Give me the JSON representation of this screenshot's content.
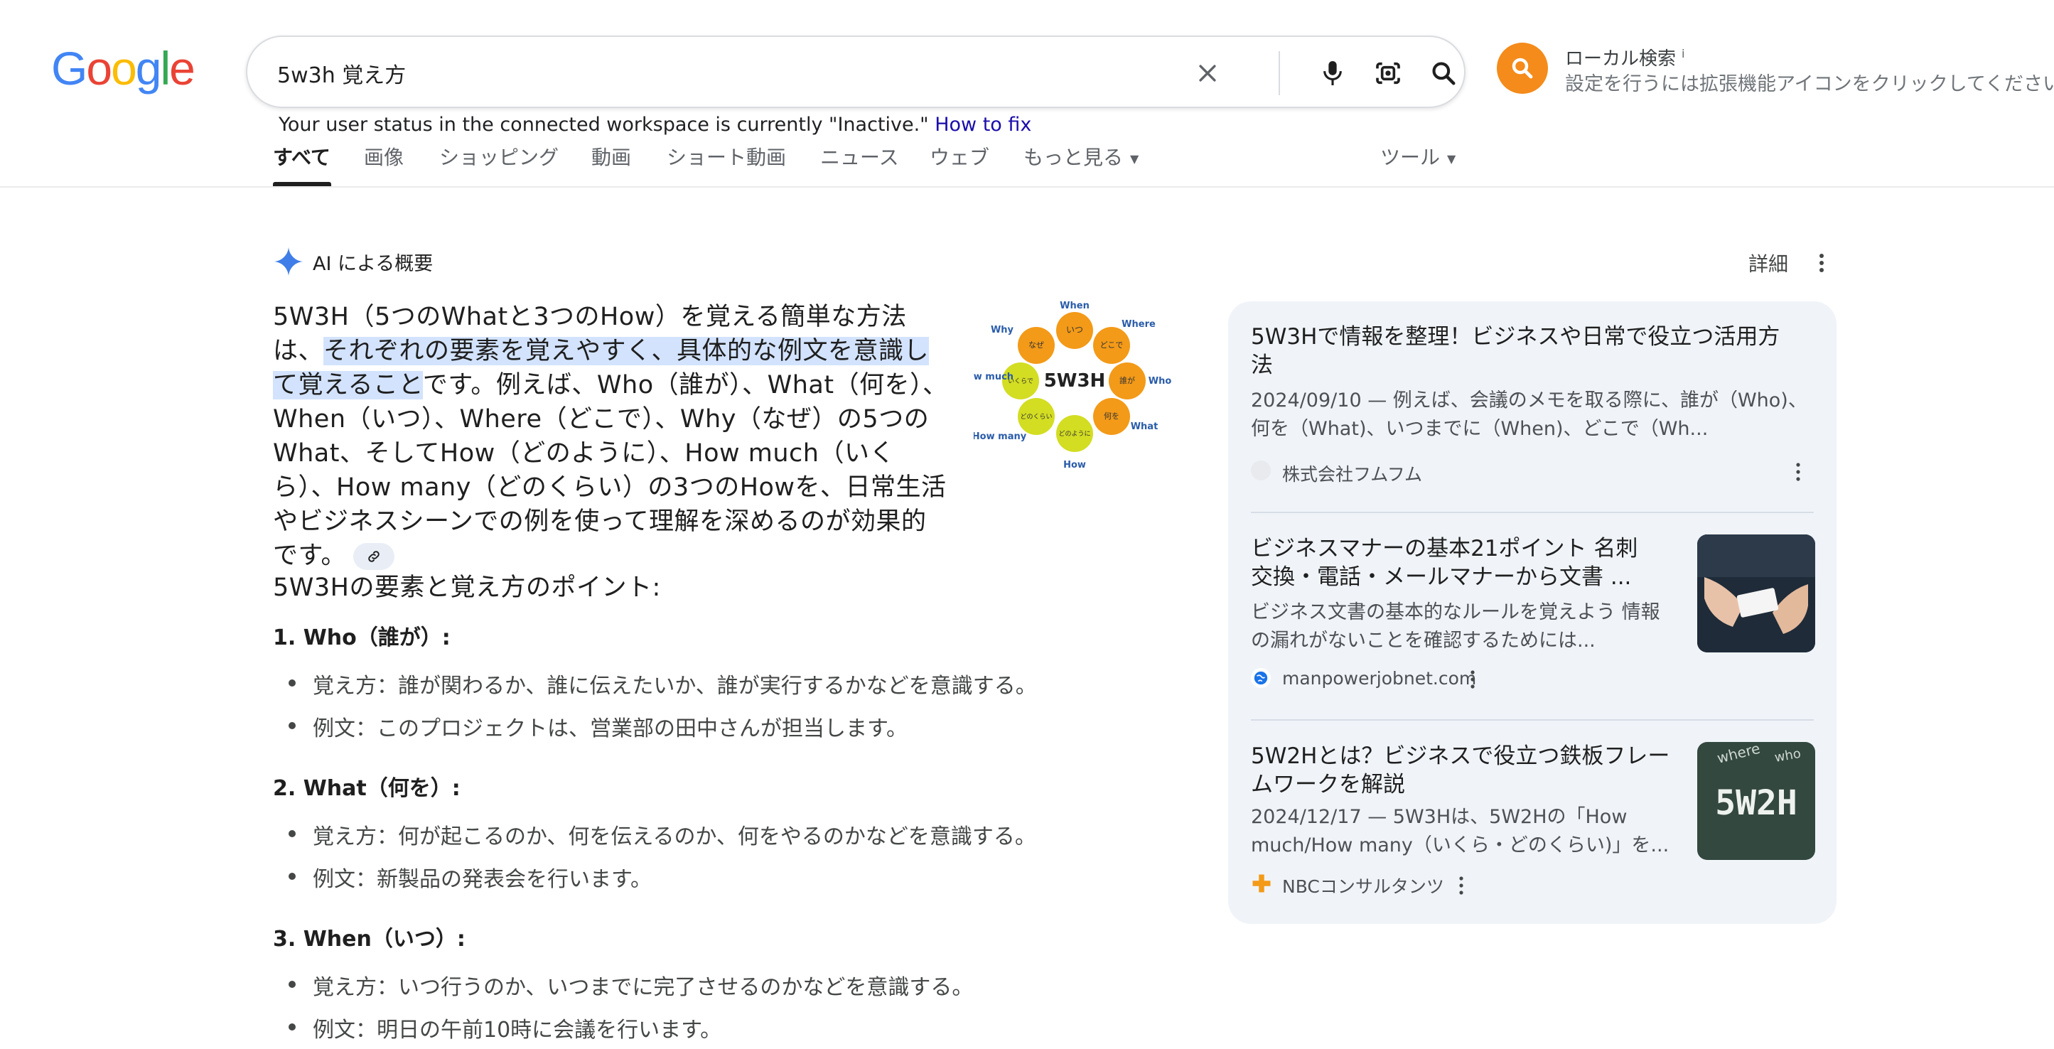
{
  "logo": {
    "text": [
      "G",
      "o",
      "o",
      "g",
      "l",
      "e"
    ],
    "colors": [
      "#4285f4",
      "#ea4335",
      "#fbbc05",
      "#4285f4",
      "#34a853",
      "#ea4335"
    ]
  },
  "search": {
    "value": "5w3h 覚え方",
    "placeholder": ""
  },
  "local_search": {
    "title": "ローカル検索",
    "info": "i",
    "subtitle": "設定を行うには拡張機能アイコンをクリックしてください",
    "accent": "#f48b1a"
  },
  "status": {
    "text": "Your user status in the connected workspace is currently \"Inactive.\"",
    "link": "How to fix"
  },
  "tabs": [
    "すべて",
    "画像",
    "ショッピング",
    "動画",
    "ショート動画",
    "ニュース",
    "ウェブ",
    "もっと見る",
    "ツール"
  ],
  "ai_overview": {
    "title": "AI による概要",
    "detail": "詳細",
    "para_1": "5W3H（5つのWhatと3つのHow）を覚える簡単な方法は、",
    "para_highlight": "それぞれの要素を覚えやすく、具体的な例文を意識して覚えること",
    "para_2": "です。例えば、Who（誰が）、What（何を）、When（いつ）、Where（どこで）、Why（なぜ）の5つのWhat、そしてHow（どのように）、How much（いくら）、How many（どのくらい）の3つのHowを、日常生活やビジネスシーンでの例を使って理解を深めるのが効果的です。",
    "diagram": {
      "center": "5W3H",
      "outer": [
        "When",
        "Where",
        "Who",
        "What",
        "How",
        "How many",
        "How much",
        "Why"
      ],
      "inner": [
        "いつ",
        "どこで",
        "誰が",
        "何を",
        "どのように",
        "どのくらい",
        "いくらで",
        "なぜ"
      ]
    },
    "points_title": "5W3Hの要素と覚え方のポイント:",
    "sections": [
      {
        "title": "1. Who（誰が）:",
        "how": "覚え方：誰が関わるか、誰に伝えたいか、誰が実行するかなどを意識する。",
        "example": "例文：このプロジェクトは、営業部の田中さんが担当します。"
      },
      {
        "title": "2. What（何を）:",
        "how": "覚え方：何が起こるのか、何を伝えるのか、何をやるのかなどを意識する。",
        "example": "例文：新製品の発表会を行います。"
      },
      {
        "title": "3. When（いつ）:",
        "how": "覚え方：いつ行うのか、いつまでに完了させるのかなどを意識する。",
        "example": "例文：明日の午前10時に会議を行います。"
      }
    ]
  },
  "sources": [
    {
      "title": "5W3Hで情報を整理！ビジネスや日常で役立つ活用方法",
      "snippet": "2024/09/10 — 例えば、会議のメモを取る際に、誰が（Who)、何を（What)、いつまでに（When)、どこで（Wh...",
      "site": "株式会社フムフム"
    },
    {
      "title": "ビジネスマナーの基本21ポイント 名刺交換・電話・メールマナーから文書 ...",
      "snippet": "ビジネス文書の基本的なルールを覚えよう 情報の漏れがないことを確認するためには...",
      "site": "manpowerjobnet.com"
    },
    {
      "title": "5W2Hとは？ビジネスで役立つ鉄板フレームワークを解説",
      "snippet": "2024/12/17 — 5W3Hは、5W2Hの「How much/How many（いくら・どのくらい)」を...",
      "site": "NBCコンサルタンツ",
      "thumb_text": "5W2H",
      "thumb_words": [
        "where",
        "who"
      ]
    }
  ]
}
